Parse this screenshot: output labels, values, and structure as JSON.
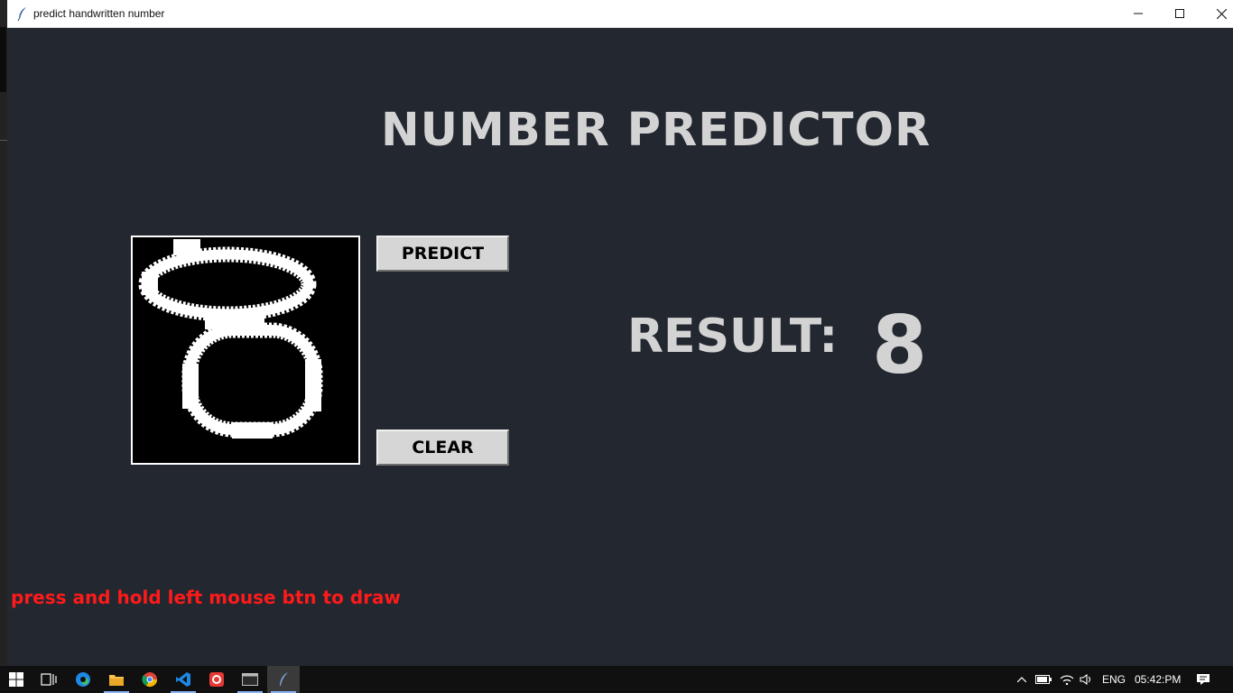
{
  "window": {
    "title": "predict handwritten number"
  },
  "app": {
    "heading": "NUMBER PREDICTOR",
    "predict_label": "PREDICT",
    "clear_label": "CLEAR",
    "result_label": "RESULT:",
    "result_value": "8",
    "hint": "press and hold left mouse btn to draw"
  },
  "taskbar": {
    "apps": [
      "start",
      "task-view",
      "edge",
      "file-explorer",
      "chrome",
      "vscode",
      "app-red",
      "terminal",
      "python-tk"
    ],
    "tray": {
      "language": "ENG",
      "time": "05:42:PM"
    }
  },
  "colors": {
    "window_bg": "#222730",
    "title_text": "#d3d3d3",
    "hint_text": "#ff1a1a",
    "button_bg": "#d6d6d6"
  }
}
